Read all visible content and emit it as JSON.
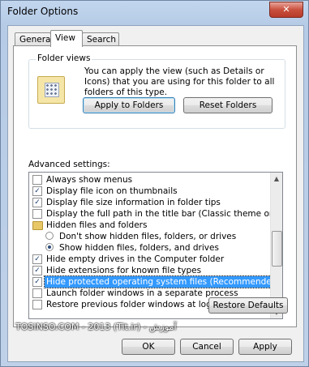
{
  "window": {
    "title": "Folder Options",
    "close_glyph": "✕"
  },
  "tabs": [
    {
      "label": "General",
      "active": false
    },
    {
      "label": "View",
      "active": true
    },
    {
      "label": "Search",
      "active": false
    }
  ],
  "folder_views": {
    "legend": "Folder views",
    "description": "You can apply the view (such as Details or Icons) that you are using for this folder to all folders of this type.",
    "apply_label": "Apply to Folders",
    "reset_label": "Reset Folders",
    "icon": "folder-views-icon"
  },
  "advanced": {
    "label": "Advanced settings:",
    "items": [
      {
        "type": "checkbox",
        "label": "Always show menus",
        "checked": false,
        "indent": 0
      },
      {
        "type": "checkbox",
        "label": "Display file icon on thumbnails",
        "checked": true,
        "indent": 0
      },
      {
        "type": "checkbox",
        "label": "Display file size information in folder tips",
        "checked": true,
        "indent": 0
      },
      {
        "type": "checkbox",
        "label": "Display the full path in the title bar (Classic theme only)",
        "checked": false,
        "indent": 0
      },
      {
        "type": "folder",
        "label": "Hidden files and folders",
        "indent": 0
      },
      {
        "type": "radio",
        "label": "Don't show hidden files, folders, or drives",
        "checked": false,
        "indent": 1
      },
      {
        "type": "radio",
        "label": "Show hidden files, folders, and drives",
        "checked": true,
        "indent": 1
      },
      {
        "type": "checkbox",
        "label": "Hide empty drives in the Computer folder",
        "checked": true,
        "indent": 0
      },
      {
        "type": "checkbox",
        "label": "Hide extensions for known file types",
        "checked": true,
        "indent": 0
      },
      {
        "type": "checkbox",
        "label": "Hide protected operating system files (Recommended)",
        "checked": true,
        "indent": 0,
        "selected": true
      },
      {
        "type": "checkbox",
        "label": "Launch folder windows in a separate process",
        "checked": false,
        "indent": 0
      },
      {
        "type": "checkbox",
        "label": "Restore previous folder windows at logon",
        "checked": false,
        "indent": 0
      }
    ]
  },
  "buttons": {
    "restore_defaults": "Restore Defaults",
    "ok": "OK",
    "cancel": "Cancel",
    "apply": "Apply"
  },
  "watermark": "TOSINSO.COM - 2013 (Tit.ir) - آموزش"
}
